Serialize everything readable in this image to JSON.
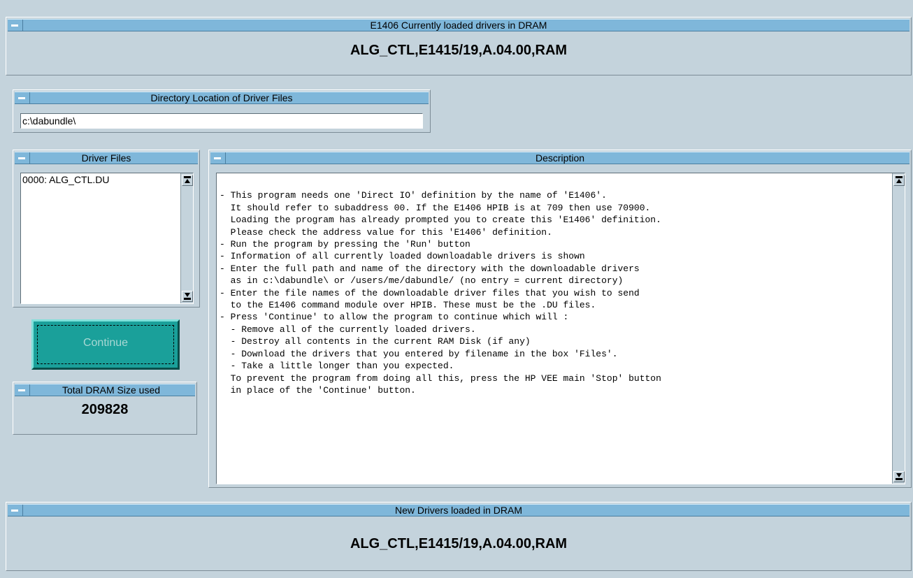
{
  "panels": {
    "current": {
      "title": "E1406 Currently loaded drivers in DRAM",
      "value": "ALG_CTL,E1415/19,A.04.00,RAM"
    },
    "directory": {
      "title": "Directory Location of Driver Files",
      "value": "c:\\dabundle\\"
    },
    "driver_files": {
      "title": "Driver Files",
      "items": [
        "0000: ALG_CTL.DU"
      ]
    },
    "description": {
      "title": "Description",
      "text": "\n- This program needs one 'Direct IO' definition by the name of 'E1406'.\n  It should refer to subaddress 00. If the E1406 HPIB is at 709 then use 70900.\n  Loading the program has already prompted you to create this 'E1406' definition.\n  Please check the address value for this 'E1406' definition.\n- Run the program by pressing the 'Run' button\n- Information of all currently loaded downloadable drivers is shown\n- Enter the full path and name of the directory with the downloadable drivers\n  as in c:\\dabundle\\ or /users/me/dabundle/ (no entry = current directory)\n- Enter the file names of the downloadable driver files that you wish to send\n  to the E1406 command module over HPIB. These must be the .DU files.\n- Press 'Continue' to allow the program to continue which will :\n  - Remove all of the currently loaded drivers.\n  - Destroy all contents in the current RAM Disk (if any)\n  - Download the drivers that you entered by filename in the box 'Files'.\n  - Take a little longer than you expected.\n  To prevent the program from doing all this, press the HP VEE main 'Stop' button\n  in place of the 'Continue' button."
    },
    "continue_button": {
      "label": "Continue"
    },
    "total_dram": {
      "title": "Total DRAM Size used",
      "value": "209828"
    },
    "new_drivers": {
      "title": "New Drivers loaded in DRAM",
      "value": "ALG_CTL,E1415/19,A.04.00,RAM"
    }
  },
  "icons": {
    "minimize": "minimize-icon",
    "scroll_up": "scroll-up-arrow-icon",
    "scroll_down": "scroll-down-arrow-icon"
  },
  "colors": {
    "background": "#c4d3dc",
    "titlebar": "#7fb7da",
    "continue_button": "#1aa09a"
  }
}
